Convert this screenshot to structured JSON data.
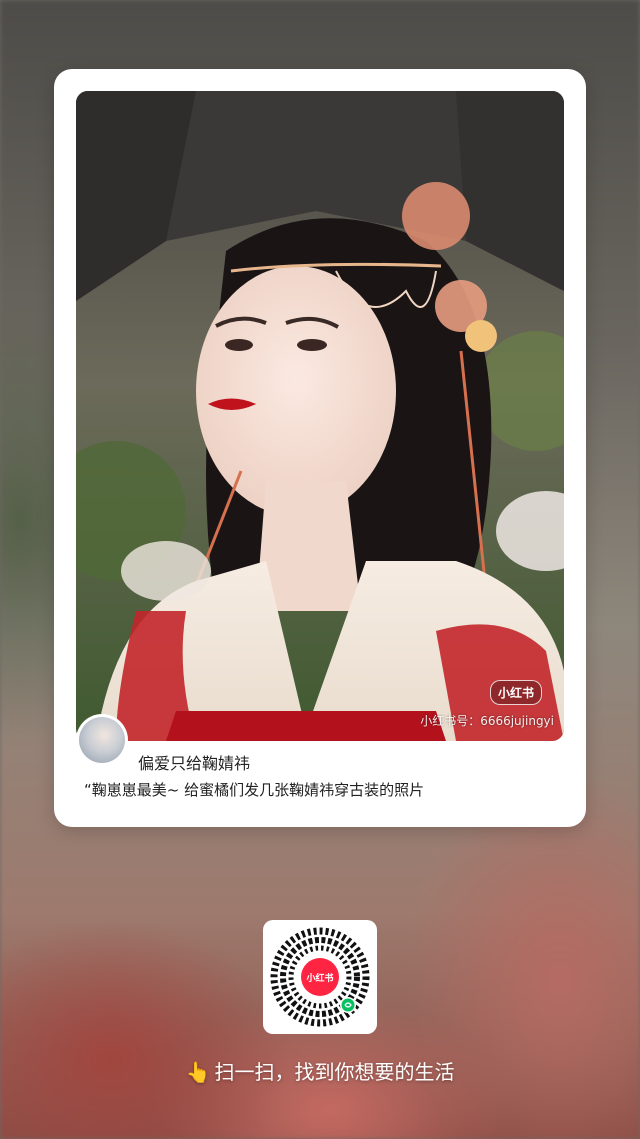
{
  "post": {
    "brand_badge": "小红书",
    "watermark": "小红书号：6666jujingyi",
    "author_name": "偏爱只给鞠婧祎",
    "caption": "“鞠崽崽最美~ 给蜜橘们发几张鞠婧祎穿古装的照片"
  },
  "qr": {
    "center_logo": "小红书",
    "icon": "qr-code-icon"
  },
  "footer": {
    "pointer_icon": "👆",
    "slogan": "扫一扫，找到你想要的生活"
  },
  "colors": {
    "brand_red": "#ff2442",
    "card_bg": "#ffffff",
    "text_dark": "#222222"
  }
}
